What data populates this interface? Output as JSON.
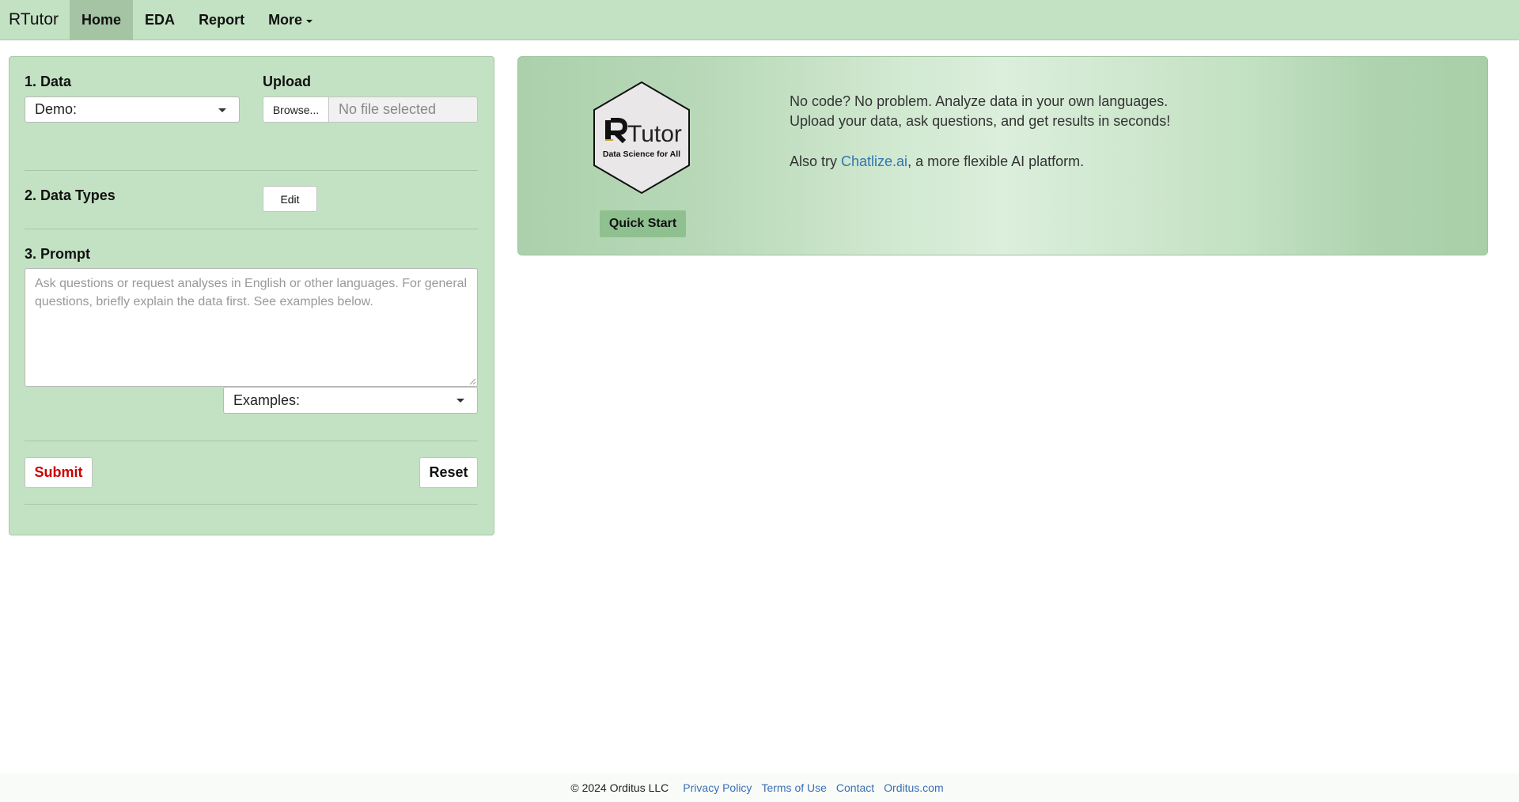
{
  "navbar": {
    "brand": "RTutor",
    "items": [
      {
        "label": "Home"
      },
      {
        "label": "EDA"
      },
      {
        "label": "Report"
      },
      {
        "label": "More"
      }
    ]
  },
  "sidebar": {
    "data_title": "1. Data",
    "data_select_value": "Demo:",
    "upload_title": "Upload",
    "browse_label": "Browse...",
    "no_file_text": "No file selected",
    "types_title": "2. Data Types",
    "edit_label": "Edit",
    "prompt_title": "3. Prompt",
    "prompt_placeholder": "Ask questions or request analyses in English or other languages. For general questions, briefly explain the data first. See examples below.",
    "examples_value": "Examples:",
    "submit_label": "Submit",
    "reset_label": "Reset"
  },
  "hero": {
    "logo_text": "RTutor",
    "logo_tagline": "Data Science for All",
    "quick_start_label": "Quick Start",
    "line1": "No code? No problem. Analyze data in your own languages.",
    "line2": "Upload your data, ask questions, and get results in seconds!",
    "also_prefix": "Also try ",
    "also_link": "Chatlize.ai",
    "also_suffix": ", a more flexible AI platform."
  },
  "footer": {
    "copyright": "© 2024 Orditus LLC",
    "links": [
      "Privacy Policy",
      "Terms of Use",
      "Contact",
      "Orditus.com"
    ]
  },
  "colors": {
    "navbar_bg": "#c3e2c3",
    "nav_active_bg": "#a4c4a4",
    "panel_bg": "#c3e2c3",
    "submit_text": "#cc0000",
    "link": "#3275b0",
    "quick_start_bg": "#8fc08f"
  }
}
